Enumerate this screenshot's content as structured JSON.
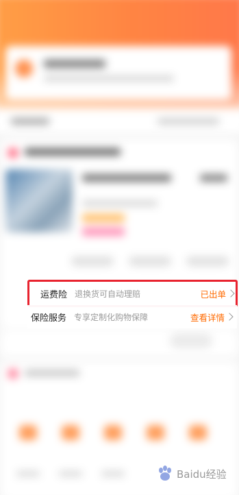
{
  "freight_insurance": {
    "label": "运费险",
    "description": "退换货可自动理赔",
    "status": "已出单"
  },
  "insurance_service": {
    "label": "保险服务",
    "description": "专享定制化购物保障",
    "action": "查看详情"
  },
  "colors": {
    "accent": "#ff6a00",
    "header": "#ff7a1e",
    "highlight_border": "#e8232f"
  },
  "watermark": {
    "brand": "Baidu经验"
  }
}
